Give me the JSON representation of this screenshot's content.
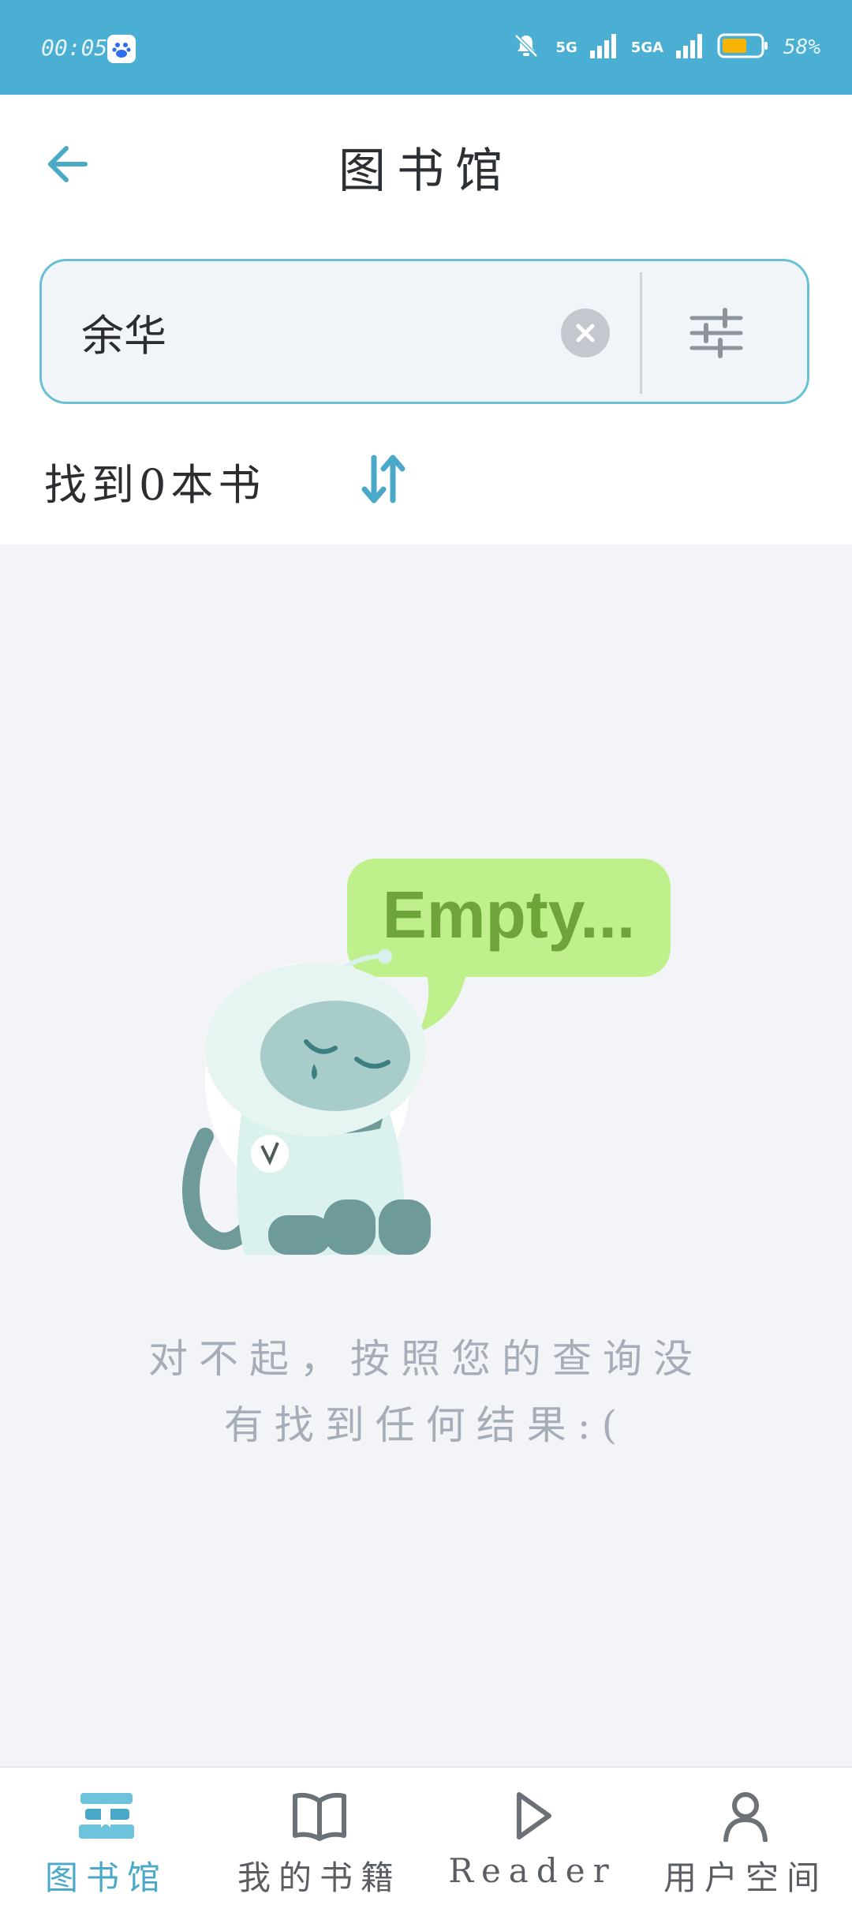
{
  "status_bar": {
    "time": "00:05",
    "signal_1": "5G",
    "signal_2": "5GA",
    "battery": "58%"
  },
  "header": {
    "title": "图书馆"
  },
  "search": {
    "value": "余华"
  },
  "results": {
    "count_text": "找到0本书"
  },
  "empty_state": {
    "bubble_text": "Empty...",
    "message_line1": "对不起，按照您的查询没",
    "message_line2": "有找到任何结果:("
  },
  "bottom_nav": {
    "items": [
      {
        "label": "图书馆",
        "icon": "library-icon",
        "active": true
      },
      {
        "label": "我的书籍",
        "icon": "book-open-icon",
        "active": false
      },
      {
        "label": "Reader",
        "icon": "play-icon",
        "active": false
      },
      {
        "label": "用户空间",
        "icon": "user-icon",
        "active": false
      }
    ]
  },
  "colors": {
    "status_bar": "#4aafd3",
    "accent": "#4aa9c8",
    "search_border": "#68c0d5",
    "bubble": "#bff08b",
    "bubble_text": "#6fa43a"
  }
}
